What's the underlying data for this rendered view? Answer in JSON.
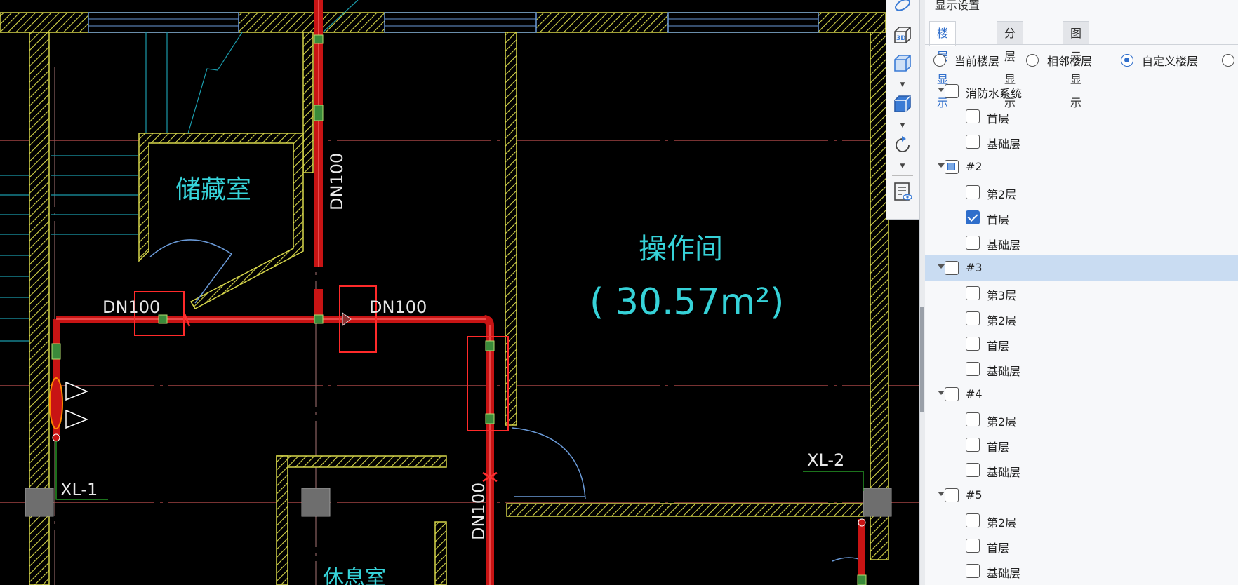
{
  "canvas": {
    "room_labels": [
      "储藏室",
      "操作间",
      "休息室"
    ],
    "area_label": "( 30.57m²)",
    "pipe_labels": [
      "DN100",
      "DN100",
      "DN100",
      "DN100"
    ],
    "riser_labels": [
      "XL-1",
      "XL-2"
    ],
    "colors": {
      "background": "#000000",
      "wall": "#d6d64a",
      "axis": "#c05050",
      "pipe": "#c81414",
      "highlight_box": "#ff2a2a",
      "text": "#36d2d8",
      "glass": "#6a9ad8"
    }
  },
  "view_toolbar": {
    "icons": [
      "orbit-icon",
      "3d-view-icon",
      "cube-view-icon",
      "cube-face-icon",
      "rotate-icon",
      "display-settings-icon"
    ]
  },
  "panel": {
    "title": "显示设置",
    "tabs": [
      {
        "label": "楼层显示",
        "active": true
      },
      {
        "label": "分层显示",
        "active": false
      },
      {
        "label": "图元显示",
        "active": false
      }
    ],
    "radios": [
      {
        "label": "当前楼层",
        "checked": false
      },
      {
        "label": "相邻楼层",
        "checked": false
      },
      {
        "label": "自定义楼层",
        "checked": true
      },
      {
        "label": "",
        "checked": false
      }
    ],
    "tree": [
      {
        "label": "消防水系统",
        "level": 0,
        "state": "unchecked",
        "selected": false
      },
      {
        "label": "首层",
        "level": 1,
        "state": "unchecked",
        "selected": false
      },
      {
        "label": "基础层",
        "level": 1,
        "state": "unchecked",
        "selected": false
      },
      {
        "label": "#2",
        "level": 0,
        "state": "partial",
        "selected": false
      },
      {
        "label": "第2层",
        "level": 1,
        "state": "unchecked",
        "selected": false
      },
      {
        "label": "首层",
        "level": 1,
        "state": "checked",
        "selected": false
      },
      {
        "label": "基础层",
        "level": 1,
        "state": "unchecked",
        "selected": false
      },
      {
        "label": "#3",
        "level": 0,
        "state": "unchecked",
        "selected": true
      },
      {
        "label": "第3层",
        "level": 1,
        "state": "unchecked",
        "selected": false
      },
      {
        "label": "第2层",
        "level": 1,
        "state": "unchecked",
        "selected": false
      },
      {
        "label": "首层",
        "level": 1,
        "state": "unchecked",
        "selected": false
      },
      {
        "label": "基础层",
        "level": 1,
        "state": "unchecked",
        "selected": false
      },
      {
        "label": "#4",
        "level": 0,
        "state": "unchecked",
        "selected": false
      },
      {
        "label": "第2层",
        "level": 1,
        "state": "unchecked",
        "selected": false
      },
      {
        "label": "首层",
        "level": 1,
        "state": "unchecked",
        "selected": false
      },
      {
        "label": "基础层",
        "level": 1,
        "state": "unchecked",
        "selected": false
      },
      {
        "label": "#5",
        "level": 0,
        "state": "unchecked",
        "selected": false
      },
      {
        "label": "第2层",
        "level": 1,
        "state": "unchecked",
        "selected": false
      },
      {
        "label": "首层",
        "level": 1,
        "state": "unchecked",
        "selected": false
      },
      {
        "label": "基础层",
        "level": 1,
        "state": "unchecked",
        "selected": false
      }
    ]
  }
}
